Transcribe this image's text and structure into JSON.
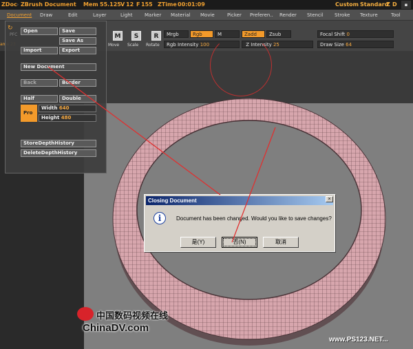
{
  "titlebar": {
    "zdoc": "ZDoc",
    "document_title": "ZBrush Document",
    "mem": "Mem",
    "mem_value": "55.125",
    "v": "V",
    "v_value": "12",
    "f": "F",
    "f_value": "155",
    "ztime": "ZTime",
    "ztime_value": "00:01:09",
    "custom": "Custom",
    "standard": "Standard",
    "z": "Z",
    "d": "D"
  },
  "menu": [
    "Document",
    "Draw",
    "Edit",
    "Layer",
    "Light",
    "Marker",
    "Material",
    "Movie",
    "Picker",
    "Preferen..",
    "Render",
    "Stencil",
    "Stroke",
    "Texture",
    "Tool"
  ],
  "toolbar": {
    "move": "Move",
    "scale": "Scale",
    "rotate": "Rotate",
    "move_key": "M",
    "scale_key": "S",
    "rotate_key": "R",
    "mrgb": "Mrgb",
    "rgb": "Rgb",
    "m": "M",
    "zadd": "Zadd",
    "zsub": "Zsub",
    "rgb_intensity_label": "Rgb Intensity",
    "rgb_intensity_value": "100",
    "z_intensity_label": "Z Intensity",
    "z_intensity_value": "25",
    "focal_shift_label": "Focal Shift",
    "focal_shift_value": "0",
    "draw_size_label": "Draw Size",
    "draw_size_value": "64",
    "left_label": "ame",
    "left_value": "23",
    "pfc": "PFC"
  },
  "palette": {
    "open": "Open",
    "save": "Save",
    "save_as": "Save As",
    "import": "Import",
    "export": "Export",
    "new_document": "New Document",
    "back": "Back",
    "border": "Border",
    "half": "Half",
    "double": "Double",
    "pro": "Pro",
    "width_label": "Width",
    "width_value": "640",
    "height_label": "Height",
    "height_value": "480",
    "store_depth": "StoreDepthHistory",
    "delete_depth": "DeleteDepthHistory"
  },
  "dialog": {
    "title": "Closing Document",
    "close": "×",
    "message": "Document has been changed. Would you like to save changes?",
    "yes": "是(Y)",
    "no": "否(N)",
    "cancel": "取消",
    "icon": "i"
  },
  "watermark": {
    "cn": "中国数码视频在线",
    "en": "ChinaDV.com",
    "right": "www.PS123.NET..."
  },
  "colors": {
    "accent": "#f39a2a",
    "ring": "#d7a6ad",
    "annotation": "#e03030"
  },
  "icons": [
    "info-icon",
    "close-icon",
    "logo-icon"
  ]
}
